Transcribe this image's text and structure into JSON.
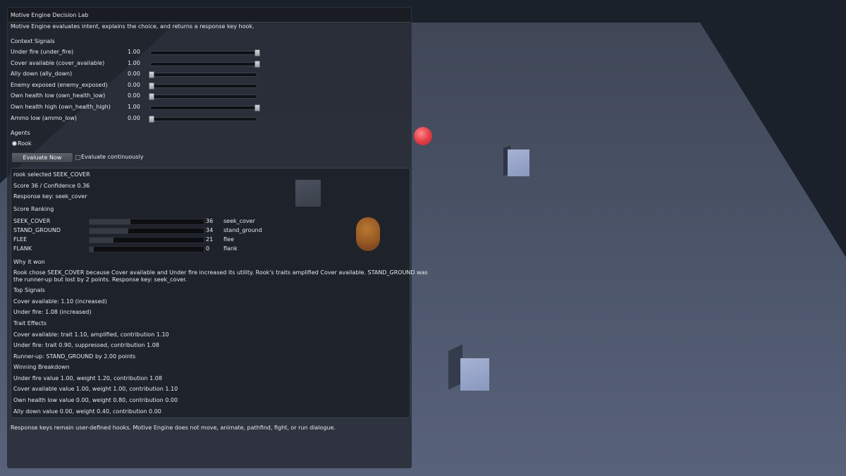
{
  "window": {
    "title": "Motive Engine Decision Lab"
  },
  "intro": "Motive Engine evaluates intent, explains the choice, and returns a response key hook.",
  "context": {
    "heading": "Context Signals",
    "signals": [
      {
        "label": "Under fire (under_fire)",
        "value_text": "1.00",
        "value": 1.0
      },
      {
        "label": "Cover available (cover_available)",
        "value_text": "1.00",
        "value": 1.0
      },
      {
        "label": "Ally down (ally_down)",
        "value_text": "0.00",
        "value": 0.0
      },
      {
        "label": "Enemy exposed (enemy_exposed)",
        "value_text": "0.00",
        "value": 0.0
      },
      {
        "label": "Own health low (own_health_low)",
        "value_text": "0.00",
        "value": 0.0
      },
      {
        "label": "Own health high (own_health_high)",
        "value_text": "1.00",
        "value": 1.0
      },
      {
        "label": "Ammo low (ammo_low)",
        "value_text": "0.00",
        "value": 0.0
      }
    ]
  },
  "agents": {
    "heading": "Agents",
    "selected": "Rook"
  },
  "actions": {
    "evaluate_label": "Evaluate Now",
    "continuous_label": "Evaluate continuously"
  },
  "result": {
    "selected_line": "rook selected SEEK_COVER",
    "score_line": "Score 36 / Confidence 0.36",
    "response_line": "Response key: seek_cover",
    "ranking_heading": "Score Ranking",
    "ranking": [
      {
        "action": "SEEK_COVER",
        "score": 36,
        "score_text": "36",
        "key": "seek_cover"
      },
      {
        "action": "STAND_GROUND",
        "score": 34,
        "score_text": "34",
        "key": "stand_ground"
      },
      {
        "action": "FLEE",
        "score": 21,
        "score_text": "21",
        "key": "flee"
      },
      {
        "action": "FLANK",
        "score": 0,
        "score_text": "0",
        "key": "flank"
      }
    ],
    "why_heading": "Why it won",
    "why_line1": "Rook chose SEEK_COVER because Cover available and Under fire increased its utility. Rook's traits amplified Cover available. STAND_GROUND was",
    "why_line2": "the runner-up but lost by 2 points. Response key: seek_cover.",
    "top_heading": "Top Signals",
    "top_signals": [
      "Cover available: 1.10 (increased)",
      "Under fire: 1.08 (increased)"
    ],
    "trait_heading": "Trait Effects",
    "trait_effects": [
      "Cover available: trait 1.10, amplified, contribution 1.10",
      "Under fire: trait 0.90, suppressed, contribution 1.08"
    ],
    "runner_up": "Runner-up: STAND_GROUND by 2.00 points",
    "breakdown_heading": "Winning Breakdown",
    "breakdown": [
      "Under fire value 1.00, weight 1.20, contribution 1.08",
      "Cover available value 1.00, weight 1.00, contribution 1.10",
      "Own health low value 0.00, weight 0.80, contribution 0.00",
      "Ally down value 0.00, weight 0.40, contribution 0.00"
    ]
  },
  "footer": "Response keys remain user-defined hooks. Motive Engine does not move, animate, pathfind, fight, or run dialogue.",
  "colors": {
    "sky": "#1a202a",
    "floor": "#4a5468",
    "panel": "#222730",
    "sphere": "#e8444c",
    "cube": "#8a98bf",
    "capsule": "#a05a22"
  }
}
